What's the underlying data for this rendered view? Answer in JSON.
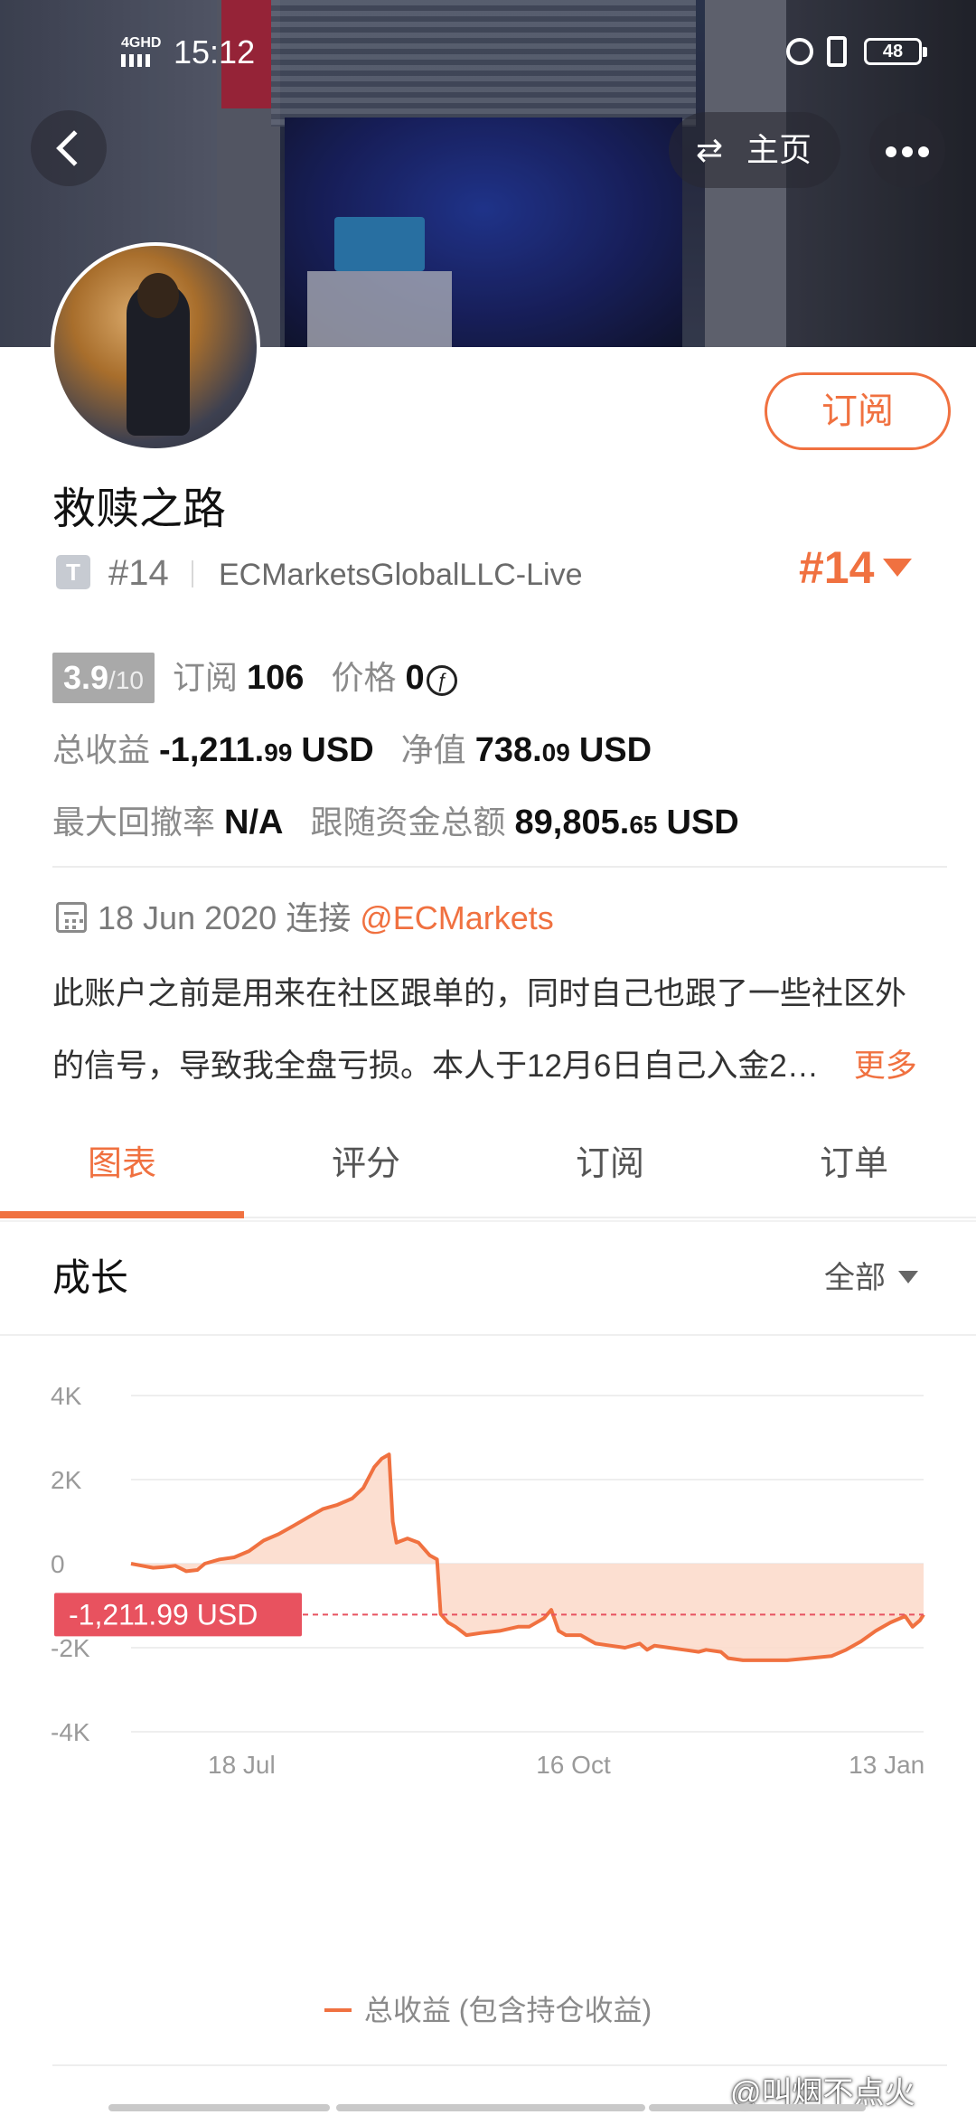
{
  "status_bar": {
    "network": "4GHD",
    "time": "15:12",
    "battery": "48"
  },
  "nav": {
    "home_label": "主页",
    "swap_icon": "⇄"
  },
  "profile": {
    "name": "救赎之路",
    "subscribe_label": "订阅",
    "tier_badge": "T",
    "rank": "#14",
    "broker": "ECMarketsGlobalLLC-Live",
    "rank_right": "#14",
    "score": "3.9",
    "score_max": "/10",
    "subscribers_label": "订阅",
    "subscribers": "106",
    "price_label": "价格",
    "price": "0",
    "price_icon": "ƒ",
    "total_profit_label": "总收益",
    "total_profit_int": "-1,211.",
    "total_profit_dec": "99",
    "total_profit_unit": "USD",
    "equity_label": "净值",
    "equity_int": "738.",
    "equity_dec": "09",
    "equity_unit": "USD",
    "max_drawdown_label": "最大回撤率",
    "max_drawdown": "N/A",
    "follow_funds_label": "跟随资金总额",
    "follow_funds_int": "89,805.",
    "follow_funds_dec": "65",
    "follow_funds_unit": "USD",
    "connect_date": "18 Jun 2020",
    "connect_label": "连接",
    "connect_handle": "@ECMarkets",
    "description_line1": "此账户之前是用来在社区跟单的，同时自己也跟了一些社区外",
    "description_line2": "的信号，导致我全盘亏损。本人于12月6日自己入金2…",
    "more_label": "更多"
  },
  "tabs": [
    {
      "label": "图表",
      "active": true
    },
    {
      "label": "评分",
      "active": false
    },
    {
      "label": "订阅",
      "active": false
    },
    {
      "label": "订单",
      "active": false
    }
  ],
  "growth": {
    "title": "成长",
    "range": "全部"
  },
  "legend": {
    "label": "总收益 (包含持仓收益)"
  },
  "watermark": "@叫烟不点火",
  "colors": {
    "accent": "#f07140",
    "fill": "#fbd9c9",
    "badge_red": "#e8525f"
  },
  "chart_data": {
    "type": "area",
    "y_ticks": [
      "4K",
      "2K",
      "0",
      "-2K",
      "-4K"
    ],
    "y_tick_values": [
      4000,
      2000,
      0,
      -2000,
      -4000
    ],
    "ylim": [
      -4000,
      4000
    ],
    "x_ticks": [
      "18 Jul",
      "16 Oct",
      "13 Jan"
    ],
    "x_tick_positions": [
      30,
      120,
      205
    ],
    "xlim": [
      0,
      215
    ],
    "current_value_label": "-1,211.99 USD",
    "current_value": -1211.99,
    "series": [
      {
        "name": "总收益 (包含持仓收益)",
        "points": [
          [
            0,
            0
          ],
          [
            3,
            -50
          ],
          [
            6,
            -100
          ],
          [
            9,
            -80
          ],
          [
            12,
            -50
          ],
          [
            15,
            -180
          ],
          [
            18,
            -150
          ],
          [
            20,
            0
          ],
          [
            24,
            100
          ],
          [
            28,
            150
          ],
          [
            32,
            300
          ],
          [
            36,
            550
          ],
          [
            40,
            700
          ],
          [
            44,
            900
          ],
          [
            48,
            1100
          ],
          [
            52,
            1300
          ],
          [
            56,
            1400
          ],
          [
            60,
            1550
          ],
          [
            63,
            1800
          ],
          [
            66,
            2300
          ],
          [
            68,
            2500
          ],
          [
            70,
            2600
          ],
          [
            71,
            1000
          ],
          [
            72,
            500
          ],
          [
            75,
            600
          ],
          [
            78,
            500
          ],
          [
            81,
            200
          ],
          [
            83,
            100
          ],
          [
            84,
            -1200
          ],
          [
            86,
            -1400
          ],
          [
            88,
            -1500
          ],
          [
            91,
            -1700
          ],
          [
            95,
            -1650
          ],
          [
            100,
            -1600
          ],
          [
            105,
            -1500
          ],
          [
            108,
            -1500
          ],
          [
            112,
            -1300
          ],
          [
            114,
            -1100
          ],
          [
            116,
            -1600
          ],
          [
            118,
            -1700
          ],
          [
            122,
            -1700
          ],
          [
            126,
            -1900
          ],
          [
            130,
            -1950
          ],
          [
            134,
            -2000
          ],
          [
            138,
            -1900
          ],
          [
            140,
            -2050
          ],
          [
            142,
            -1950
          ],
          [
            146,
            -2000
          ],
          [
            150,
            -2050
          ],
          [
            154,
            -2100
          ],
          [
            156,
            -2050
          ],
          [
            160,
            -2100
          ],
          [
            162,
            -2250
          ],
          [
            166,
            -2300
          ],
          [
            172,
            -2300
          ],
          [
            178,
            -2300
          ],
          [
            184,
            -2250
          ],
          [
            190,
            -2200
          ],
          [
            194,
            -2050
          ],
          [
            198,
            -1850
          ],
          [
            202,
            -1600
          ],
          [
            206,
            -1400
          ],
          [
            210,
            -1250
          ],
          [
            212,
            -1500
          ],
          [
            214,
            -1350
          ],
          [
            215,
            -1212
          ]
        ]
      }
    ]
  }
}
